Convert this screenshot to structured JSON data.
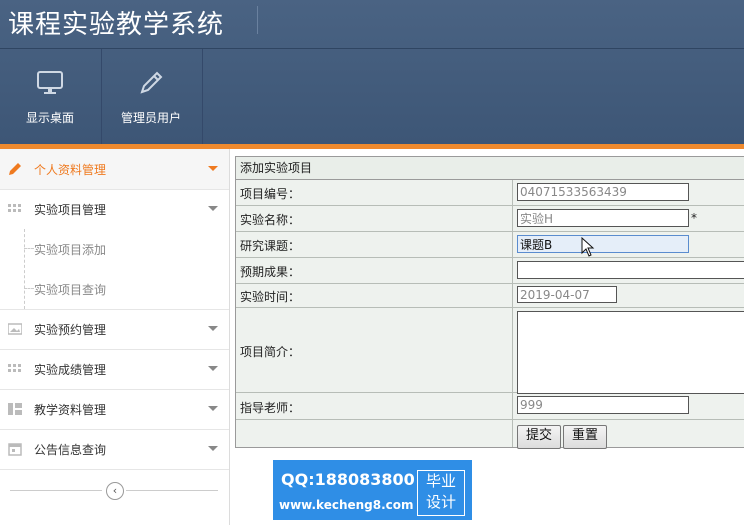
{
  "app": {
    "title": "课程实验教学系统"
  },
  "toolbar": [
    {
      "label": "显示桌面",
      "icon": "monitor-icon"
    },
    {
      "label": "管理员用户",
      "icon": "pencil-icon"
    }
  ],
  "sidebar": {
    "items": [
      {
        "label": "个人资料管理",
        "icon": "pencil-icon",
        "active": true
      },
      {
        "label": "实验项目管理",
        "icon": "grid-icon"
      },
      {
        "label": "实验预约管理",
        "icon": "image-icon"
      },
      {
        "label": "实验成绩管理",
        "icon": "grid-icon"
      },
      {
        "label": "教学资料管理",
        "icon": "layout-icon"
      },
      {
        "label": "公告信息查询",
        "icon": "calendar-icon"
      }
    ],
    "sub_items": [
      {
        "label": "实验项目添加"
      },
      {
        "label": "实验项目查询"
      }
    ],
    "collapse_glyph": "‹"
  },
  "form": {
    "title": "添加实验项目",
    "fields": {
      "code": {
        "label": "项目编号：",
        "value": "04071533563439"
      },
      "name": {
        "label": "实验名称：",
        "value": "实验H",
        "required_mark": "*"
      },
      "topic": {
        "label": "研究课题：",
        "value": "课题B"
      },
      "outcome": {
        "label": "预期成果：",
        "value": ""
      },
      "time": {
        "label": "实验时间：",
        "value": "2019-04-07"
      },
      "intro": {
        "label": "项目简介：",
        "value": ""
      },
      "teacher": {
        "label": "指导老师：",
        "value": "999"
      }
    },
    "submit_label": "提交",
    "reset_label": "重置"
  },
  "watermark": {
    "qq": "QQ:188083800",
    "url": "www.kecheng8.com",
    "tag_line1": "毕业",
    "tag_line2": "设计"
  },
  "colors": {
    "header": "#45607f",
    "accent": "#ef8a2e",
    "form_bg": "#eef2ee",
    "watermark": "#2f8ee6"
  }
}
